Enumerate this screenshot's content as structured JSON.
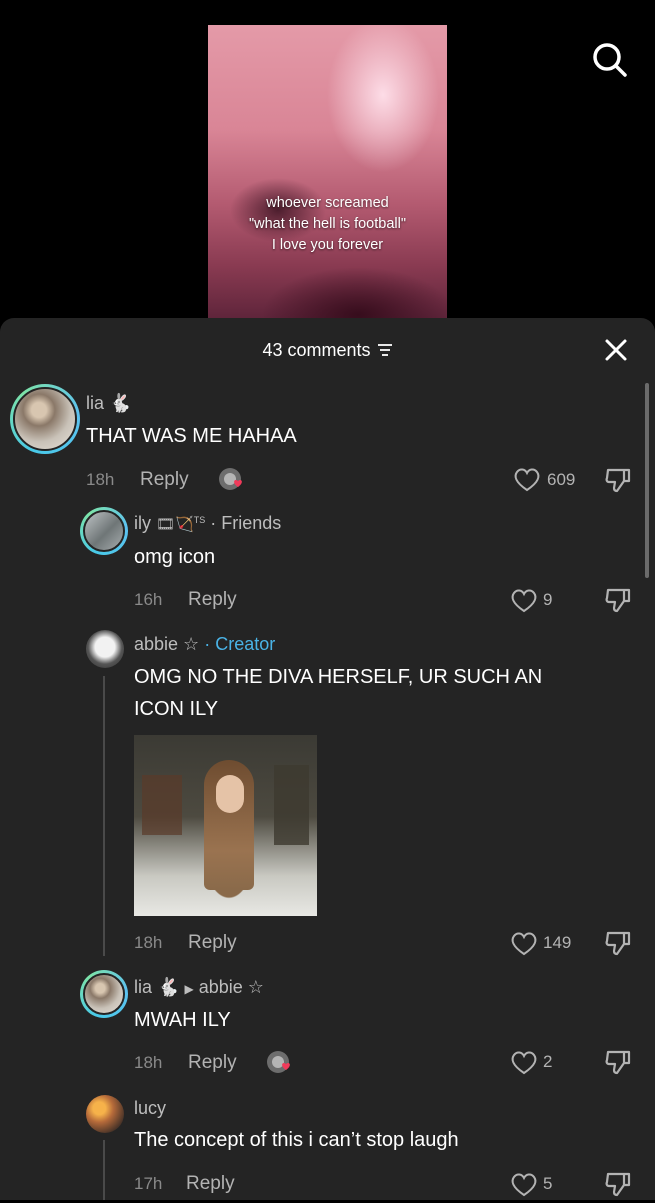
{
  "video": {
    "caption_lines": [
      "whoever screamed",
      "\"what the hell is football\"",
      "I love you forever"
    ]
  },
  "header": {
    "comments_count": "43 comments"
  },
  "comments": [
    {
      "name": "lia",
      "text": "THAT WAS ME HAHAA",
      "time": "18h",
      "reply_label": "Reply",
      "likes": "609"
    },
    {
      "name": "ily",
      "badge": "· Friends",
      "text": "omg icon",
      "time": "16h",
      "reply_label": "Reply",
      "likes": "9"
    },
    {
      "name": "abbie ☆",
      "badge": "· Creator",
      "text_line1": "OMG NO THE DIVA HERSELF, UR SUCH AN",
      "text_line2": "ICON ILY",
      "time": "18h",
      "reply_label": "Reply",
      "likes": "149"
    },
    {
      "name": "lia",
      "reply_to": "abbie ☆",
      "text": "MWAH ILY",
      "time": "18h",
      "reply_label": "Reply",
      "likes": "2"
    },
    {
      "name": "lucy",
      "text": "The concept of this i can’t stop laugh",
      "time": "17h",
      "reply_label": "Reply",
      "likes": "5"
    }
  ],
  "icons": {
    "search": "search-icon",
    "close": "close-icon",
    "filter": "filter-icon",
    "like": "heart-outline-icon",
    "dislike": "thumbs-down-icon",
    "creator_liked": "creator-liked-icon"
  },
  "colors": {
    "sheet_bg": "#242424",
    "creator_accent": "#4ab3e6",
    "ring_gradient_start": "#48c9e8",
    "ring_gradient_end": "#7de3a8"
  }
}
